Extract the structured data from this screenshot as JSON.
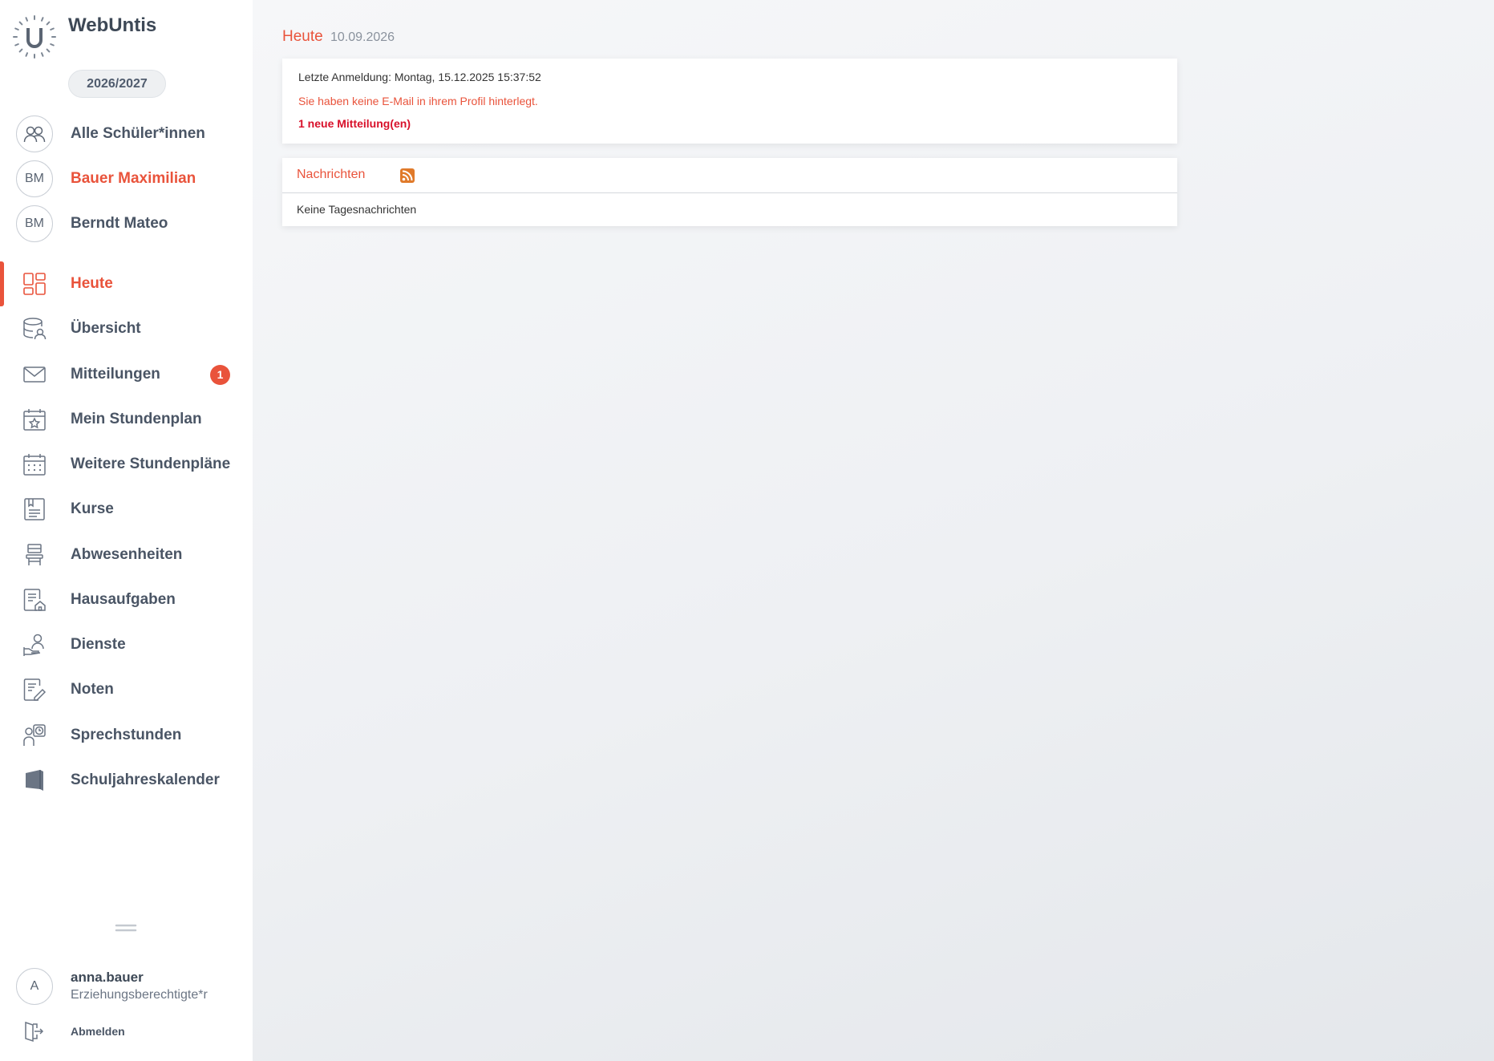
{
  "app": {
    "title": "WebUntis"
  },
  "school_year": "2026/2027",
  "students": [
    {
      "label": "Alle Schüler*innen",
      "icon": "group-icon"
    },
    {
      "label": "Bauer Maximilian",
      "initials": "BM",
      "active": true
    },
    {
      "label": "Berndt Mateo",
      "initials": "BM",
      "active": false
    }
  ],
  "nav": {
    "items": [
      {
        "label": "Heute",
        "icon": "dashboard-icon",
        "active": true
      },
      {
        "label": "Übersicht",
        "icon": "overview-icon"
      },
      {
        "label": "Mitteilungen",
        "icon": "mail-icon",
        "badge": "1"
      },
      {
        "label": "Mein Stundenplan",
        "icon": "calendar-star-icon"
      },
      {
        "label": "Weitere Stundenpläne",
        "icon": "calendar-grid-icon"
      },
      {
        "label": "Kurse",
        "icon": "courses-icon"
      },
      {
        "label": "Abwesenheiten",
        "icon": "chair-icon"
      },
      {
        "label": "Hausaufgaben",
        "icon": "homework-icon"
      },
      {
        "label": "Dienste",
        "icon": "duty-icon"
      },
      {
        "label": "Noten",
        "icon": "grades-icon"
      },
      {
        "label": "Sprechstunden",
        "icon": "office-hours-icon"
      },
      {
        "label": "Schuljahreskalender",
        "icon": "year-calendar-icon"
      }
    ]
  },
  "user": {
    "initial": "A",
    "name": "anna.bauer",
    "role": "Erziehungsberechtigte*r",
    "logout_label": "Abmelden"
  },
  "main": {
    "heading": "Heute",
    "date": "10.09.2026",
    "info_card": {
      "last_login": "Letzte Anmeldung: Montag, 15.12.2025 15:37:52",
      "email_warning": "Sie haben keine E-Mail in ihrem Profil hinterlegt.",
      "new_messages": "1 neue Mitteilung(en)"
    },
    "news_card": {
      "title": "Nachrichten",
      "empty_text": "Keine Tagesnachrichten"
    }
  },
  "colors": {
    "accent": "#e9533b",
    "alert_red": "#d8102a",
    "text": "#4a5565"
  }
}
